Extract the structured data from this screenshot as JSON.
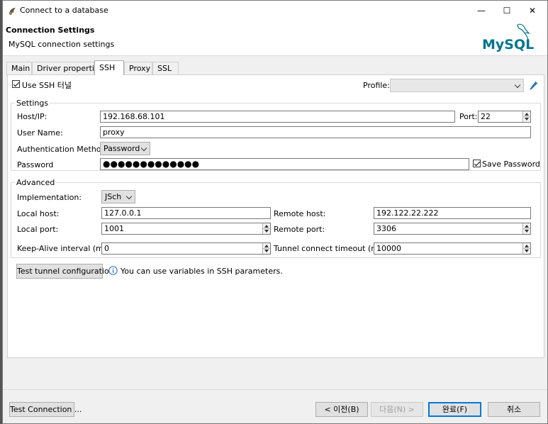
{
  "window": {
    "title": "Connect to a database",
    "minimize": "—",
    "maximize": "☐",
    "close": "✕"
  },
  "header": {
    "title": "Connection Settings",
    "subtitle": "MySQL connection settings",
    "logo_text": "MySQL"
  },
  "tabs": [
    {
      "label": "Main"
    },
    {
      "label": "Driver properties"
    },
    {
      "label": "SSH"
    },
    {
      "label": "Proxy"
    },
    {
      "label": "SSL"
    }
  ],
  "ssh": {
    "use_ssh_label": "Use SSH 터널",
    "profile_label": "Profile:",
    "profile_value": ""
  },
  "settings": {
    "legend": "Settings",
    "host_label": "Host/IP:",
    "host_value": "192.168.68.101",
    "port_label": "Port:",
    "port_value": "22",
    "user_label": "User Name:",
    "user_value": "proxy",
    "auth_label": "Authentication Method:",
    "auth_value": "Password",
    "password_label": "Password",
    "password_value": "●●●●●●●●●●●●●",
    "save_password_label": "Save Password"
  },
  "advanced": {
    "legend": "Advanced",
    "impl_label": "Implementation:",
    "impl_value": "JSch",
    "local_host_label": "Local host:",
    "local_host_value": "127.0.0.1",
    "remote_host_label": "Remote host:",
    "remote_host_value": "192.122.22.222",
    "local_port_label": "Local port:",
    "local_port_value": "1001",
    "remote_port_label": "Remote port:",
    "remote_port_value": "3306",
    "keepalive_label": "Keep-Alive interval (ms):",
    "keepalive_value": "0",
    "tunnel_timeout_label": "Tunnel connect timeout (ms):",
    "tunnel_timeout_value": "10000"
  },
  "test_tunnel": {
    "button": "Test tunnel configuration",
    "info": "You can use variables in SSH parameters."
  },
  "footer": {
    "test_connection": "Test Connection ...",
    "back": "< 이전(B)",
    "next": "다음(N) >",
    "finish": "완료(F)",
    "cancel": "취소"
  },
  "colors": {
    "accent": "#0078d7",
    "mysql_blue": "#00758f",
    "mysql_orange": "#f29111"
  }
}
